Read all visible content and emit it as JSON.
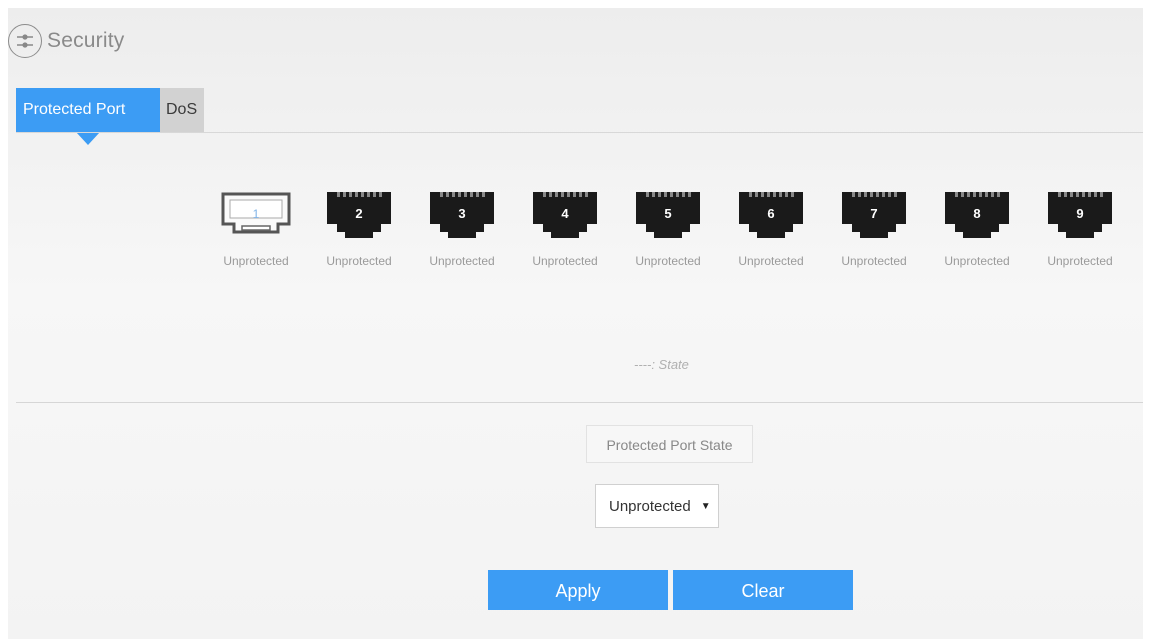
{
  "header": {
    "title": "Security",
    "icon": "settings-sliders-icon"
  },
  "tabs": [
    {
      "label": "Protected Port",
      "active": true
    },
    {
      "label": "DoS",
      "active": false
    }
  ],
  "ports": [
    {
      "number": "1",
      "status": "Unprotected",
      "selected": true
    },
    {
      "number": "2",
      "status": "Unprotected",
      "selected": false
    },
    {
      "number": "3",
      "status": "Unprotected",
      "selected": false
    },
    {
      "number": "4",
      "status": "Unprotected",
      "selected": false
    },
    {
      "number": "5",
      "status": "Unprotected",
      "selected": false
    },
    {
      "number": "6",
      "status": "Unprotected",
      "selected": false
    },
    {
      "number": "7",
      "status": "Unprotected",
      "selected": false
    },
    {
      "number": "8",
      "status": "Unprotected",
      "selected": false
    },
    {
      "number": "9",
      "status": "Unprotected",
      "selected": false
    }
  ],
  "legend": {
    "text": "----: State"
  },
  "form": {
    "state_label": "Protected Port State",
    "state_value": "Unprotected",
    "caret": "▼"
  },
  "buttons": {
    "apply": "Apply",
    "clear": "Clear"
  },
  "colors": {
    "accent": "#3c9cf4",
    "port_jack": "#1a1a1a",
    "tab_inactive": "#d2d2d2"
  }
}
